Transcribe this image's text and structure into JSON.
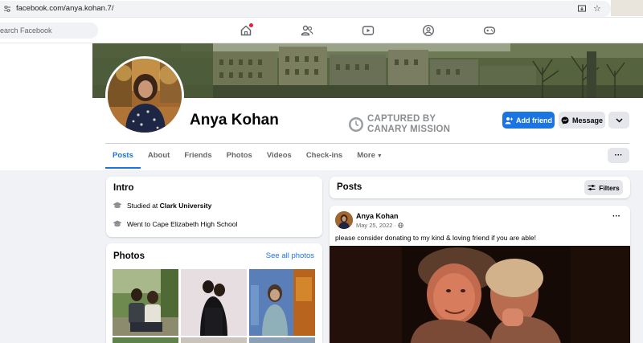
{
  "browser": {
    "url": "facebook.com/anya.kohan.7/"
  },
  "nav": {
    "search_placeholder": "Search Facebook",
    "icons": [
      "home-icon",
      "friends-icon",
      "watch-icon",
      "groups-icon",
      "gaming-icon"
    ],
    "notification_color": "#e41e3f"
  },
  "profile": {
    "name": "Anya Kohan",
    "add_friend": "Add friend",
    "message": "Message"
  },
  "watermark": {
    "line1": "CAPTURED BY",
    "line2": "CANARY MISSION"
  },
  "tabs": [
    {
      "label": "Posts",
      "active": true
    },
    {
      "label": "About"
    },
    {
      "label": "Friends"
    },
    {
      "label": "Photos"
    },
    {
      "label": "Videos"
    },
    {
      "label": "Check-ins"
    },
    {
      "label": "More"
    }
  ],
  "intro": {
    "title": "Intro",
    "rows": [
      {
        "prefix": "Studied at ",
        "bold": "Clark University"
      },
      {
        "prefix": "Went to Cape Elizabeth High School",
        "bold": ""
      }
    ]
  },
  "photos": {
    "title": "Photos",
    "see_all": "See all photos"
  },
  "posts": {
    "title": "Posts",
    "filters": "Filters",
    "items": [
      {
        "author": "Anya Kohan",
        "date": "May 25, 2022 · ",
        "text": "please consider donating to my kind & loving friend if you are able!"
      }
    ]
  },
  "colors": {
    "accent": "#1b74e4",
    "bg": "#f0f2f5",
    "muted": "#65676b"
  }
}
